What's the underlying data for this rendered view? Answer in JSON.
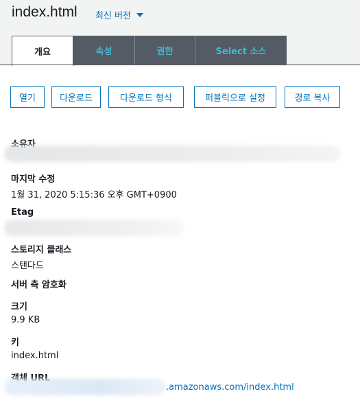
{
  "header": {
    "title": "index.html",
    "version_label": "최신 버전"
  },
  "tabs": [
    {
      "label": "개요",
      "active": true
    },
    {
      "label": "속성",
      "active": false
    },
    {
      "label": "권한",
      "active": false
    },
    {
      "label": "Select 소스",
      "active": false
    }
  ],
  "actions": [
    {
      "label": "열기"
    },
    {
      "label": "다운로드"
    },
    {
      "label": "다운로드 형식"
    },
    {
      "label": "퍼블릭으로 설정"
    },
    {
      "label": "경로 복사"
    }
  ],
  "details": {
    "owner_label": "소유자",
    "last_modified_label": "마지막 수정",
    "last_modified_value": "1월 31, 2020 5:15:36 오후 GMT+0900",
    "etag_label": "Etag",
    "storage_class_label": "스토리지 클래스",
    "storage_class_value": "스탠다드",
    "encryption_label": "서버 측 암호화",
    "size_label": "크기",
    "size_value": "9.9 KB",
    "key_label": "키",
    "key_value": "index.html",
    "url_label": "객체 URL",
    "url_value": ".amazonaws.com/index.html"
  },
  "colors": {
    "link": "#0073bb",
    "tab_bg": "#545b64",
    "tab_text": "#44b9d6",
    "header_bg": "#f2f3f3"
  }
}
